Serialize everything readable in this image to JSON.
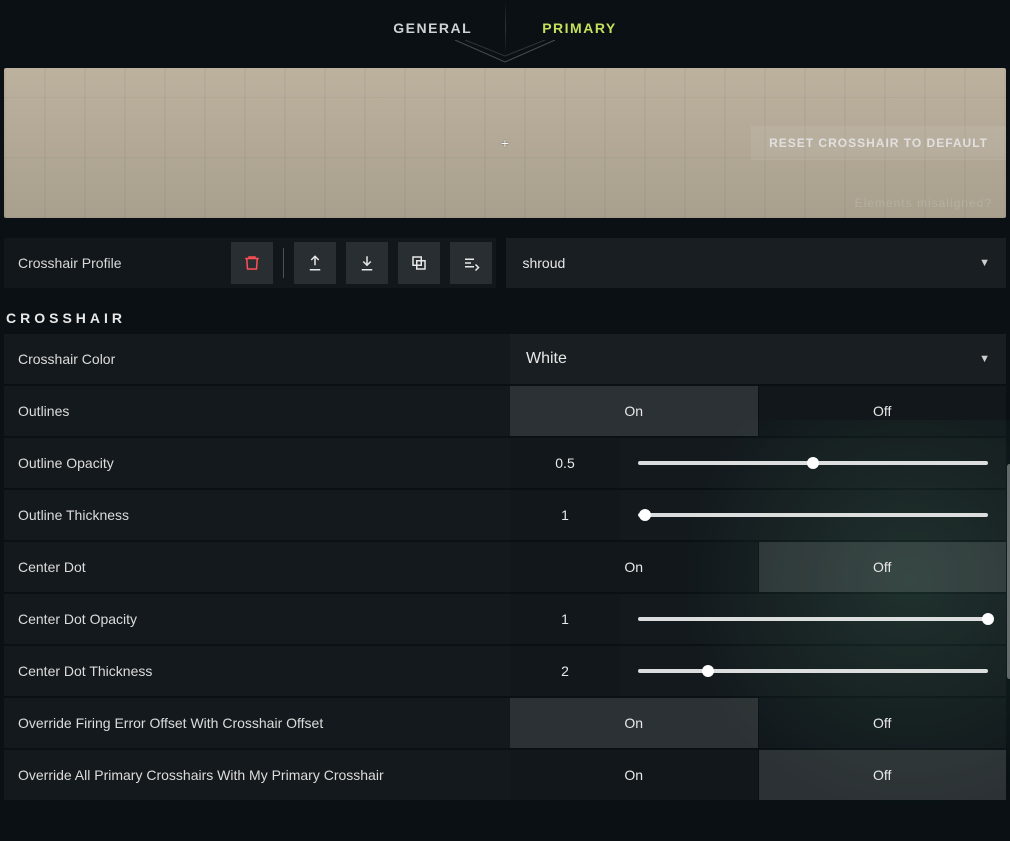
{
  "tabs": {
    "general": "GENERAL",
    "primary": "PRIMARY"
  },
  "preview": {
    "reset_label": "RESET CROSSHAIR TO DEFAULT",
    "misaligned_label": "Elements misaligned?",
    "crosshair_symbol": "+"
  },
  "profile": {
    "label": "Crosshair Profile",
    "selected": "shroud"
  },
  "section_title": "CROSSHAIR",
  "common": {
    "on": "On",
    "off": "Off"
  },
  "settings": {
    "color": {
      "label": "Crosshair Color",
      "value": "White"
    },
    "outlines": {
      "label": "Outlines",
      "value": "On"
    },
    "outline_opacity": {
      "label": "Outline Opacity",
      "value": "0.5",
      "pct": 50
    },
    "outline_thickness": {
      "label": "Outline Thickness",
      "value": "1",
      "pct": 2
    },
    "center_dot": {
      "label": "Center Dot",
      "value": "Off"
    },
    "center_dot_opacity": {
      "label": "Center Dot Opacity",
      "value": "1",
      "pct": 100
    },
    "center_dot_thickness": {
      "label": "Center Dot Thickness",
      "value": "2",
      "pct": 20
    },
    "override_firing": {
      "label": "Override Firing Error Offset With Crosshair Offset",
      "value": "On"
    },
    "override_all": {
      "label": "Override All Primary Crosshairs With My Primary Crosshair",
      "value": "Off"
    }
  }
}
